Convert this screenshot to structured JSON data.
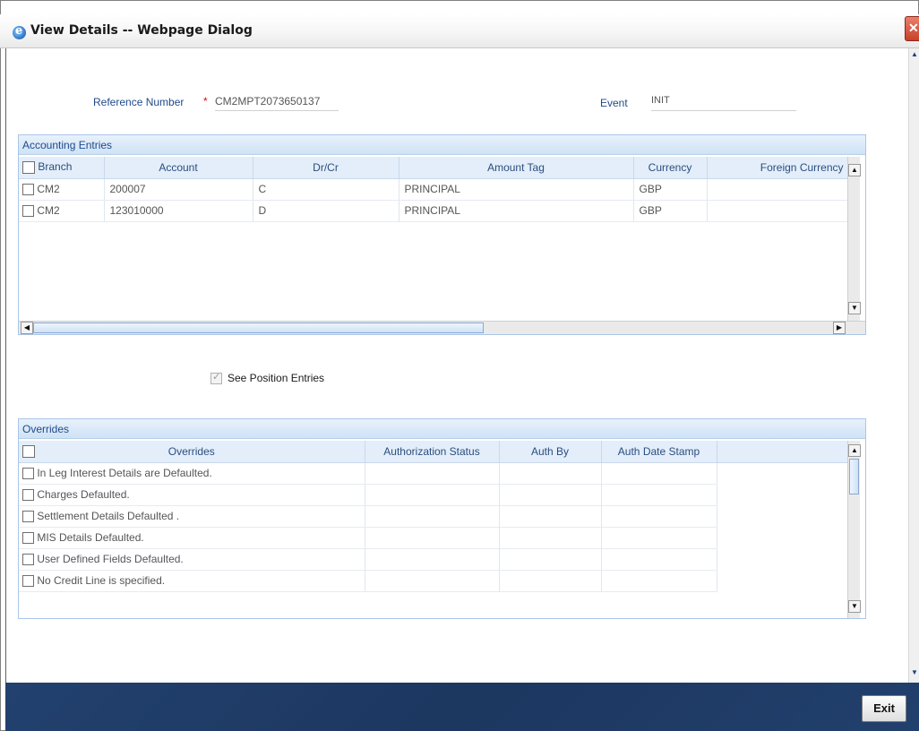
{
  "window": {
    "title": "View Details -- Webpage Dialog"
  },
  "header": {
    "reference_label": "Reference Number",
    "reference_value": "CM2MPT2073650137",
    "event_label": "Event",
    "event_value": "INIT"
  },
  "accounting": {
    "title": "Accounting Entries",
    "columns": [
      "Branch",
      "Account",
      "Dr/Cr",
      "Amount Tag",
      "Currency",
      "Foreign Currency"
    ],
    "rows": [
      [
        "CM2",
        "200007",
        "C",
        "PRINCIPAL",
        "GBP",
        ""
      ],
      [
        "CM2",
        "123010000",
        "D",
        "PRINCIPAL",
        "GBP",
        ""
      ]
    ]
  },
  "see_position": {
    "label": "See Position Entries",
    "checked": true
  },
  "overrides": {
    "title": "Overrides",
    "columns": [
      "Overrides",
      "Authorization Status",
      "Auth By",
      "Auth Date Stamp"
    ],
    "rows": [
      [
        "In Leg Interest Details are Defaulted.",
        "",
        "",
        ""
      ],
      [
        "Charges Defaulted.",
        "",
        "",
        ""
      ],
      [
        "Settlement Details Defaulted .",
        "",
        "",
        ""
      ],
      [
        "MIS Details Defaulted.",
        "",
        "",
        ""
      ],
      [
        "User Defined Fields Defaulted.",
        "",
        "",
        ""
      ],
      [
        "No Credit Line is specified.",
        "",
        "",
        ""
      ]
    ]
  },
  "footer": {
    "exit_label": "Exit"
  },
  "colors": {
    "footer_bg": "#1f3b66",
    "panel_header": "#cfe2f6",
    "label_blue": "#1f4a8a",
    "required": "#d01010"
  }
}
